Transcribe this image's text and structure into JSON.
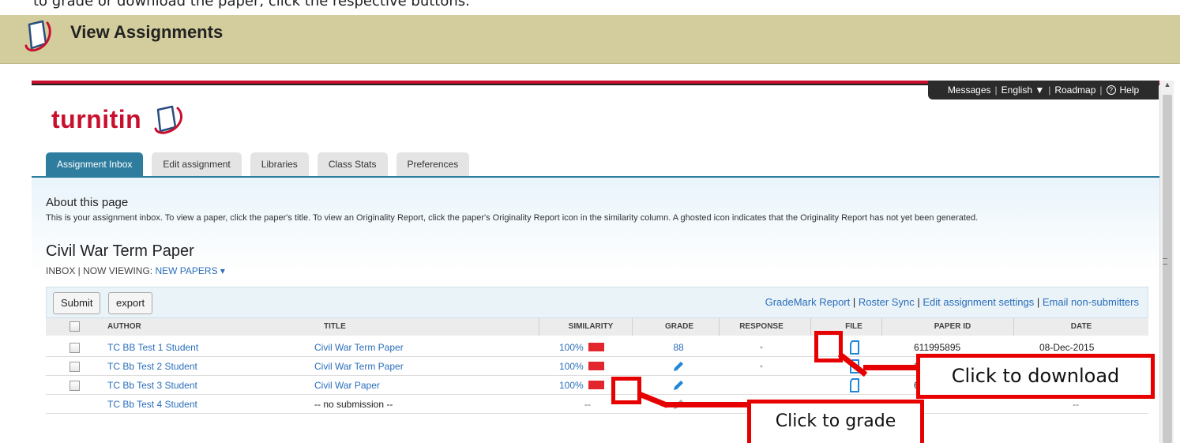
{
  "caption": "to grade or download the paper, click the respective buttons.",
  "header": {
    "title": "View Assignments",
    "icon": "turnitin-logo-icon"
  },
  "brand": {
    "logo_text": "turnitin",
    "color": "#c8102e",
    "accent": "#2f7d9e"
  },
  "topbar": {
    "items": [
      "Messages",
      "English ▼",
      "Roadmap",
      "Help"
    ],
    "sep": "|",
    "help_glyph": "?"
  },
  "tabs": [
    "Assignment Inbox",
    "Edit assignment",
    "Libraries",
    "Class Stats",
    "Preferences"
  ],
  "about": {
    "title": "About this page",
    "text": "This is your assignment inbox. To view a paper, click the paper's title. To view an Originality Report, click the paper's Originality Report icon in the similarity column. A ghosted icon indicates that the Originality Report has not yet been generated."
  },
  "assignment": {
    "title": "Civil War Term Paper",
    "viewing_prefix": "INBOX | NOW VIEWING:",
    "viewing_value": "NEW PAPERS ▾"
  },
  "toolbar": {
    "submit": "Submit",
    "export": "export",
    "links": [
      "GradeMark Report",
      "Roster Sync",
      "Edit assignment settings",
      "Email non-submitters"
    ],
    "sep": "|"
  },
  "table": {
    "columns": [
      "AUTHOR",
      "TITLE",
      "SIMILARITY",
      "GRADE",
      "RESPONSE",
      "FILE",
      "PAPER ID",
      "DATE"
    ],
    "rows": [
      {
        "author": "TC BB Test 1 Student",
        "title": "Civil War Term Paper",
        "similarity": "100%",
        "grade": "88",
        "response": "•",
        "paper_id": "611995895",
        "date": "08-Dec-2015"
      },
      {
        "author": "TC Bb Test 2 Student",
        "title": "Civil War Term Paper",
        "similarity": "100%",
        "grade": "pencil-icon",
        "response": "•",
        "paper_id": "6",
        "date": ""
      },
      {
        "author": "TC Bb Test 3 Student",
        "title": "Civil War Paper",
        "similarity": "100%",
        "grade": "pencil-icon",
        "response": "",
        "paper_id": "6",
        "date": ""
      },
      {
        "author": "TC Bb Test 4 Student",
        "title": "-- no submission --",
        "similarity": "--",
        "grade": "pencil-icon-ghosted",
        "response": "",
        "paper_id": "--",
        "date": "--"
      }
    ]
  },
  "annotations": {
    "download": "Click to download",
    "grade": "Click to grade",
    "color": "#e60000"
  }
}
